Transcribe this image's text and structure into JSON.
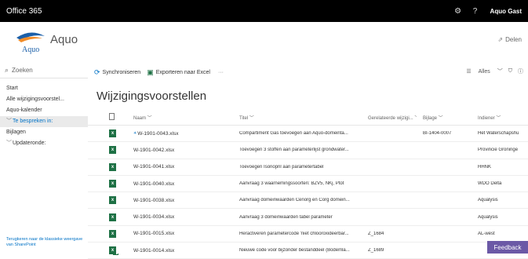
{
  "topbar": {
    "brand": "Office 365",
    "user": "Aquo Gast"
  },
  "site": {
    "name": "Aquo",
    "logo_text": "Aquo",
    "share": "Delen"
  },
  "search": {
    "placeholder": "Zoeken"
  },
  "nav": [
    {
      "label": "Start",
      "selected": false,
      "chevron": ""
    },
    {
      "label": "Alle wijzigingsvoorstel...",
      "selected": false,
      "chevron": ""
    },
    {
      "label": "Aquo-kalender",
      "selected": false,
      "chevron": ""
    },
    {
      "label": "Te bespreken in:",
      "selected": true,
      "chevron": "﹀"
    },
    {
      "label": "Bijlagen",
      "selected": false,
      "chevron": ""
    },
    {
      "label": "Updateronde:",
      "selected": false,
      "chevron": "﹀"
    }
  ],
  "classic_link": "Terugkeren naar de klassieke weergave van SharePoint",
  "cmdbar": {
    "sync": "Synchroniseren",
    "export": "Exporteren naar Excel",
    "more": "···",
    "view": "Alles"
  },
  "page_title": "Wijzigingsvoorstellen",
  "columns": {
    "name": "Naam",
    "title": "Titel",
    "related": "Gerelateerde wijzigi...",
    "attachment": "Bijlage",
    "submitter": "Indiener"
  },
  "rows": [
    {
      "name": "W-1901-0043.xlsx",
      "title": "Compartiment Gas toevoegen aan Aquo-domeinta...",
      "related": "",
      "attachment": "BI-1404-0007",
      "submitter": "Het Waterschapshu",
      "new": true
    },
    {
      "name": "W-1901-0042.xlsx",
      "title": "Toevoegen 3 stoffen aan parameterlijst grondwater...",
      "related": "",
      "attachment": "",
      "submitter": "Provincie Groninge",
      "new": false
    },
    {
      "name": "W-1901-0041.xlsx",
      "title": "Toevoegen Isonopril aan parametertabel",
      "related": "",
      "attachment": "",
      "submitter": "HHNK",
      "new": false
    },
    {
      "name": "W-1901-0040.xlsx",
      "title": "Aanvraag 3 waarnemingssoorten: BZV5, NKj, Ptot",
      "related": "",
      "attachment": "",
      "submitter": "WDO Delta",
      "new": false
    },
    {
      "name": "W-1901-0038.xlsx",
      "title": "Aanvraag domeinwaarden Cenorg en Corg domein...",
      "related": "",
      "attachment": "",
      "submitter": "Aqualysis",
      "new": false
    },
    {
      "name": "W-1901-0034.xlsx",
      "title": "Aanvraag 3 domeinwaarden tabel parameter",
      "related": "",
      "attachment": "",
      "submitter": "Aqualysis",
      "new": false
    },
    {
      "name": "W-1901-0015.xlsx",
      "title": "Heractiveren parametercode 'niet chlooroxideerbar...",
      "related": "Z_1684",
      "attachment": "",
      "submitter": "AL-west",
      "new": false
    },
    {
      "name": "W-1901-0014.xlsx",
      "title": "Nieuwe code voor bijzonder bestanddeel (Bodemla...",
      "related": "Z_1689",
      "attachment": "",
      "submitter": "",
      "new": false
    }
  ],
  "feedback": "Feedback",
  "colors": {
    "topbar": "#000000",
    "accent": "#0072c6",
    "excel": "#1e7145",
    "feedback": "#6b59a6"
  }
}
